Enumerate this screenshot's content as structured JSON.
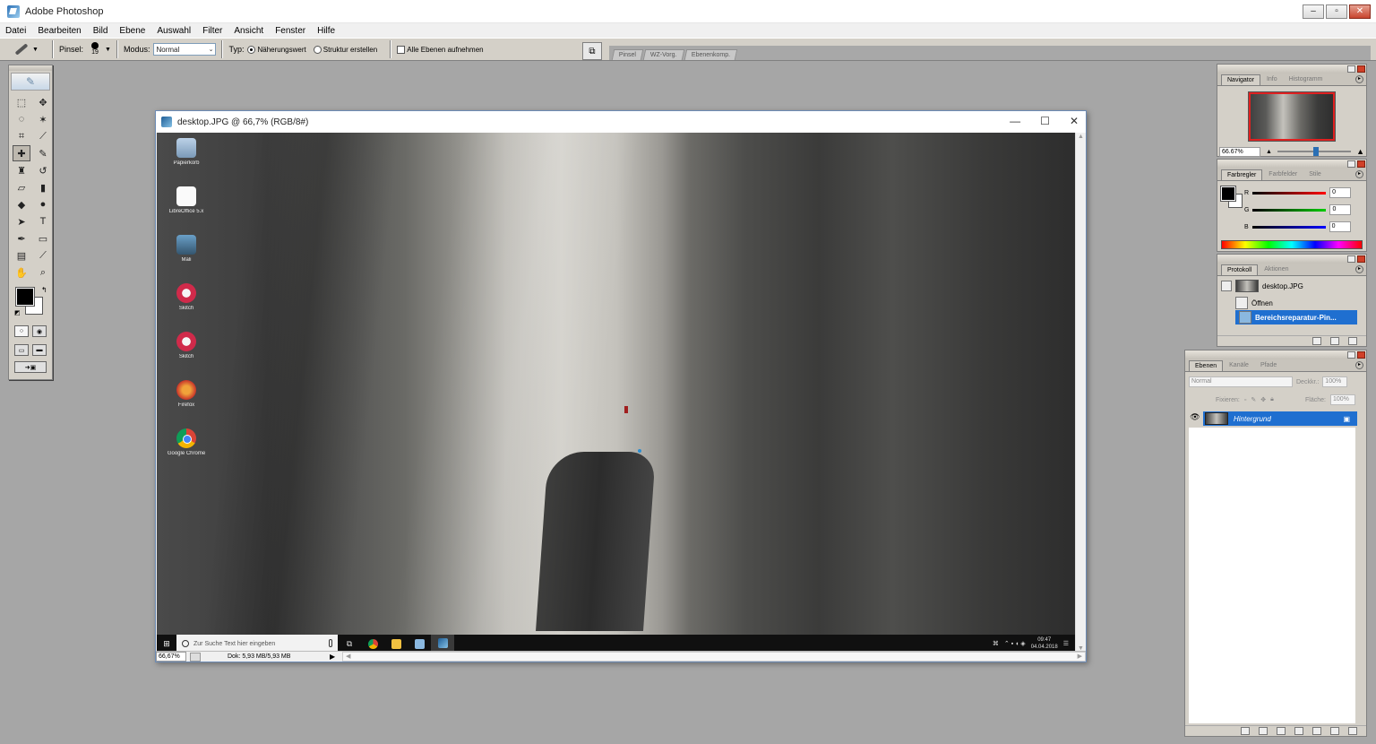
{
  "app": {
    "title": "Adobe Photoshop"
  },
  "menu": [
    "Datei",
    "Bearbeiten",
    "Bild",
    "Ebene",
    "Auswahl",
    "Filter",
    "Ansicht",
    "Fenster",
    "Hilfe"
  ],
  "options": {
    "brush_label": "Pinsel:",
    "brush_size": "19",
    "mode_label": "Modus:",
    "mode_value": "Normal",
    "type_label": "Typ:",
    "type_option1": "Näherungswert",
    "type_option2": "Struktur erstellen",
    "all_layers": "Alle Ebenen aufnehmen"
  },
  "palette_well": {
    "tabs": [
      "Pinsel",
      "WZ-Vorg.",
      "Ebenenkomp."
    ]
  },
  "document": {
    "title": "desktop.JPG @ 66,7% (RGB/8#)",
    "zoom": "66,67%",
    "doc_info": "Dok: 5,93 MB/5,93 MB",
    "desktop_icons": [
      "Papierkorb",
      "LibreOffice 5.x",
      "Mali",
      "Skitch",
      "Skitch",
      "Firefox",
      "Google Chrome"
    ],
    "taskbar": {
      "search_placeholder": "Zur Suche Text hier eingeben",
      "time": "09:47",
      "date": "04.04.2018"
    }
  },
  "navigator": {
    "tabs": [
      "Navigator",
      "Info",
      "Histogramm"
    ],
    "zoom": "66.67%"
  },
  "color": {
    "tabs": [
      "Farbregler",
      "Farbfelder",
      "Stile"
    ],
    "channels": [
      {
        "label": "R",
        "value": "0",
        "color": "#d01010"
      },
      {
        "label": "G",
        "value": "0",
        "color": "#10a020"
      },
      {
        "label": "B",
        "value": "0",
        "color": "#1020c0"
      }
    ]
  },
  "history": {
    "tabs": [
      "Protokoll",
      "Aktionen"
    ],
    "snapshot": "desktop.JPG",
    "items": [
      "Öffnen",
      "Bereichsreparatur-Pin..."
    ]
  },
  "layers": {
    "tabs": [
      "Ebenen",
      "Kanäle",
      "Pfade"
    ],
    "blend_mode": "Normal",
    "opacity_label": "Deckkr.:",
    "opacity": "100%",
    "lock_label": "Fixieren:",
    "fill_label": "Fläche:",
    "fill": "100%",
    "layer_name": "Hintergrund"
  }
}
